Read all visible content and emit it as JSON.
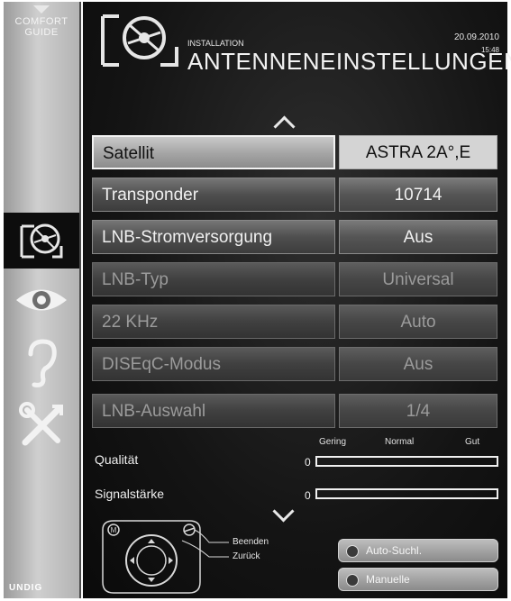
{
  "sidebar": {
    "comfort_guide_line1": "COMFORT",
    "comfort_guide_line2": "GUIDE",
    "brand": "UNDIG"
  },
  "header": {
    "section": "INSTALLATION",
    "title": "ANTENNENEINSTELLUNGEN",
    "date": "20.09.2010",
    "time": "15:48"
  },
  "settings": [
    {
      "label": "Satellit",
      "value": "ASTRA 2A°,E",
      "state": "selected"
    },
    {
      "label": "Transponder",
      "value": "10714",
      "state": "enabled"
    },
    {
      "label": "LNB-Stromversorgung",
      "value": "Aus",
      "state": "enabled"
    },
    {
      "label": "LNB-Typ",
      "value": "Universal",
      "state": "disabled"
    },
    {
      "label": "22 KHz",
      "value": "Auto",
      "state": "disabled"
    },
    {
      "label": "DISEqC-Modus",
      "value": "Aus",
      "state": "disabled"
    },
    {
      "label": "LNB-Auswahl",
      "value": "1/4",
      "state": "disabled"
    }
  ],
  "meters": {
    "scale": {
      "low": "Gering",
      "mid": "Normal",
      "high": "Gut"
    },
    "quality": {
      "label": "Qualität",
      "value_text": "0",
      "level": 0
    },
    "signal": {
      "label": "Signalstärke",
      "value_text": "0",
      "level": 0
    }
  },
  "remote": {
    "exit_label": "Beenden",
    "back_label": "Zurück",
    "m_key": "M"
  },
  "actions": {
    "auto_search": "Auto-Suchl.",
    "manual": "Manuelle"
  }
}
